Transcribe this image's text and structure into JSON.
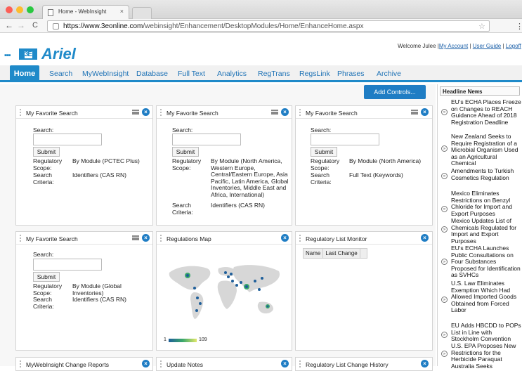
{
  "browser": {
    "tab_title": "Home - WebInsight",
    "url_domain": "https://www.3eonline.com",
    "url_path": "/webinsight/Enhancement/DesktopModules/Home/EnhanceHome.aspx"
  },
  "header": {
    "logo_mark": "3E",
    "logo_text": "Ariel",
    "welcome": "Welcome Julee |",
    "my_account": "My Account",
    "user_guide": "User Guide",
    "logoff": "Logoff",
    "sep": "|"
  },
  "nav": {
    "home": "Home",
    "search": "Search",
    "mywebinsight": "MyWebInsight",
    "database": "Database",
    "fulltext": "Full Text",
    "analytics": "Analytics",
    "regtrans": "RegTrans",
    "regslink": "RegsLink",
    "phrases": "Phrases",
    "archive": "Archive"
  },
  "add_controls": "Add Controls...",
  "panels": {
    "fav1": {
      "title": "My Favorite Search",
      "search_label": "Search:",
      "submit": "Submit",
      "reg_label": "Regulatory Scope:",
      "reg_value": "By Module (PCTEC Plus)",
      "crit_label": "Search Criteria:",
      "crit_value": "Identifiers (CAS RN)"
    },
    "fav2": {
      "title": "My Favorite Search",
      "search_label": "Search:",
      "submit": "Submit",
      "reg_label": "Regulatory Scope:",
      "reg_value": "By Module (North America, Western Europe, Central/Eastern Europe, Asia Pacific, Latin America, Global Inventories, Middle East and Africa, International)",
      "crit_label": "Search Criteria:",
      "crit_value": "Identifiers (CAS RN)"
    },
    "fav3": {
      "title": "My Favorite Search",
      "search_label": "Search:",
      "submit": "Submit",
      "reg_label": "Regulatory Scope:",
      "reg_value": "By Module (North America)",
      "crit_label": "Search Criteria:",
      "crit_value": "Full Text (Keywords)"
    },
    "fav4": {
      "title": "My Favorite Search",
      "search_label": "Search:",
      "submit": "Submit",
      "reg_label": "Regulatory Scope:",
      "reg_value": "By Module (Global Inventories)",
      "crit_label": "Search Criteria:",
      "crit_value": "Identifiers (CAS RN)"
    },
    "map": {
      "title": "Regulations Map",
      "legend_min": "1",
      "legend_max": "109"
    },
    "rlm": {
      "title": "Regulatory List Monitor",
      "col_name": "Name",
      "col_last_change": "Last Change"
    },
    "bottom1": "MyWebInsight Change Reports",
    "bottom2": "Update Notes",
    "bottom3": "Regulatory List Change History"
  },
  "news": {
    "heading": "Headline News",
    "items": [
      "EU's ECHA Places Freeze on Changes to REACH Guidance Ahead of 2018 Registration Deadline",
      "New Zealand Seeks to Require Registration of a Microbial Organism Used as an Agricultural Chemical",
      "Amendments to Turkish Cosmetics Regulation",
      "Mexico Eliminates Restrictions on Benzyl Chloride for Import and Export Purposes",
      "Mexico Updates List of Chemicals Regulated for Import and Export Purposes",
      "EU's ECHA Launches Public Consultations on Four Substances Proposed for Identification as SVHCs",
      "U.S. Law Eliminates Exemption Which Had Allowed Imported Goods Obtained from Forced Labor",
      "EU Adds HBCDD to POPs List in Line with Stockholm Convention",
      "U.S. EPA Proposes New Restrictions for the Herbicide Paraquat",
      "Australia Seeks"
    ]
  }
}
